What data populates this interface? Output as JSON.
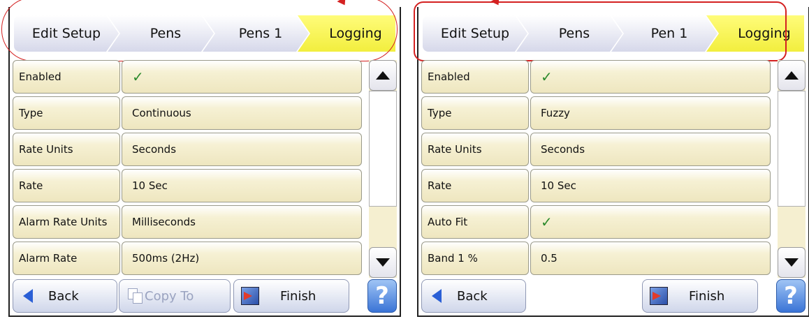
{
  "screens": [
    {
      "breadcrumb": [
        "Edit Setup",
        "Pens",
        "Pens 1",
        "Logging"
      ],
      "rows": [
        {
          "label": "Enabled",
          "value": "✓",
          "check": true
        },
        {
          "label": "Type",
          "value": "Continuous"
        },
        {
          "label": "Rate Units",
          "value": "Seconds"
        },
        {
          "label": "Rate",
          "value": "10 Sec"
        },
        {
          "label": "Alarm Rate Units",
          "value": "Milliseconds"
        },
        {
          "label": "Alarm Rate",
          "value": "500ms (2Hz)"
        }
      ],
      "footer": {
        "back": "Back",
        "copy_to": "Copy To",
        "finish": "Finish",
        "help": "?"
      }
    },
    {
      "breadcrumb": [
        "Edit Setup",
        "Pens",
        "Pen 1",
        "Logging"
      ],
      "rows": [
        {
          "label": "Enabled",
          "value": "✓",
          "check": true
        },
        {
          "label": "Type",
          "value": "Fuzzy"
        },
        {
          "label": "Rate Units",
          "value": "Seconds"
        },
        {
          "label": "Rate",
          "value": "10 Sec"
        },
        {
          "label": "Auto Fit",
          "value": "✓",
          "check": true
        },
        {
          "label": "Band 1 %",
          "value": "0.5"
        }
      ],
      "footer": {
        "back": "Back",
        "finish": "Finish",
        "help": "?"
      }
    }
  ],
  "icons": {
    "check": "check-icon",
    "scroll_up": "scroll-up-icon",
    "scroll_down": "scroll-down-icon",
    "back": "back-arrow-icon",
    "copy": "copy-icon",
    "finish": "finish-icon",
    "help": "help-icon"
  },
  "colors": {
    "active_crumb": "#f2ee3e",
    "row_fill": "#eee6bf",
    "check": "#2c8a2c",
    "highlight": "#d42121",
    "help": "#3a74d6"
  }
}
